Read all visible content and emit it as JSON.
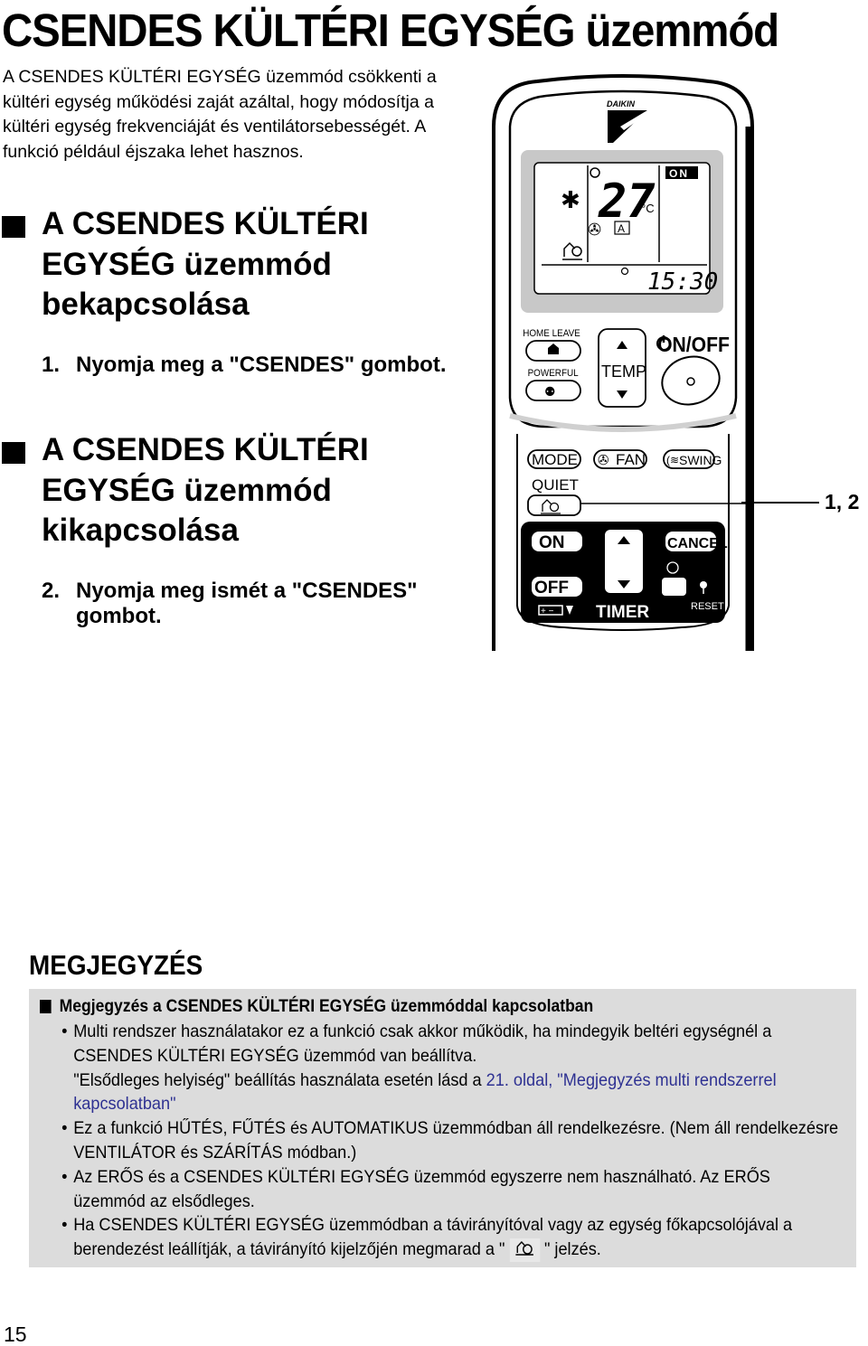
{
  "page": {
    "title": "CSENDES KÜLTÉRI EGYSÉG üzemmód",
    "intro": "A CSENDES KÜLTÉRI EGYSÉG üzemmód csökkenti a kültéri egység működési zaját azáltal, hogy módosítja a kültéri egység frekvenciáját és ventilátorsebességét. A funkció például éjszaka lehet hasznos.",
    "page_number": "15"
  },
  "sections": [
    {
      "heading": "A CSENDES KÜLTÉRI EGYSÉG üzemmód bekapcsolása",
      "step_number": "1.",
      "step_text": "Nyomja meg a \"CSENDES\" gombot."
    },
    {
      "heading": "A CSENDES KÜLTÉRI EGYSÉG üzemmód kikapcsolása",
      "step_number": "2.",
      "step_text": "Nyomja meg ismét a \"CSENDES\" gombot."
    }
  ],
  "remote": {
    "brand": "DAIKIN",
    "display": {
      "temperature": "27",
      "unit": "°C",
      "status": "ON",
      "time": "15:30",
      "fan_mode": "A"
    },
    "buttons": {
      "home_leave": "HOME LEAVE",
      "powerful": "POWERFUL",
      "temp": "TEMP",
      "on_off": "ON/OFF",
      "mode": "MODE",
      "fan": "FAN",
      "swing": "SWING",
      "quiet": "QUIET",
      "timer_on": "ON",
      "timer_off": "OFF",
      "cancel": "CANCEL",
      "timer": "TIMER",
      "reset": "RESET"
    },
    "callout": "1, 2"
  },
  "note": {
    "title": "MEGJEGYZÉS",
    "subtitle": "Megjegyzés a CSENDES KÜLTÉRI EGYSÉG üzemmóddal kapcsolatban",
    "bullets": [
      {
        "text": "Multi rendszer használatakor ez a funkció csak akkor működik, ha mindegyik beltéri egységnél a CSENDES KÜLTÉRI EGYSÉG üzemmód van beállítva.",
        "text2": "\"Elsődleges helyiség\" beállítás használata esetén lásd a ",
        "link": "21. oldal, \"Megjegyzés multi rendszerrel kapcsolatban\""
      },
      {
        "text": "Ez a funkció HŰTÉS, FŰTÉS és AUTOMATIKUS üzemmódban áll rendelkezésre. (Nem áll rendelkezésre VENTILÁTOR és SZÁRÍTÁS módban.)"
      },
      {
        "text": "Az ERŐS és a CSENDES KÜLTÉRI EGYSÉG üzemmód egyszerre nem használható. Az ERŐS üzemmód az elsődleges."
      },
      {
        "text_before": "Ha CSENDES KÜLTÉRI EGYSÉG üzemmódban a távirányítóval vagy az egység főkapcsolójával a berendezést leállítják, a távirányító kijelzőjén megmarad a \"",
        "text_after": "\" jelzés."
      }
    ]
  },
  "colors": {
    "note_background": "#dcdcdc",
    "link": "#2e3192",
    "lcd_frame": "#c8c8c8"
  }
}
